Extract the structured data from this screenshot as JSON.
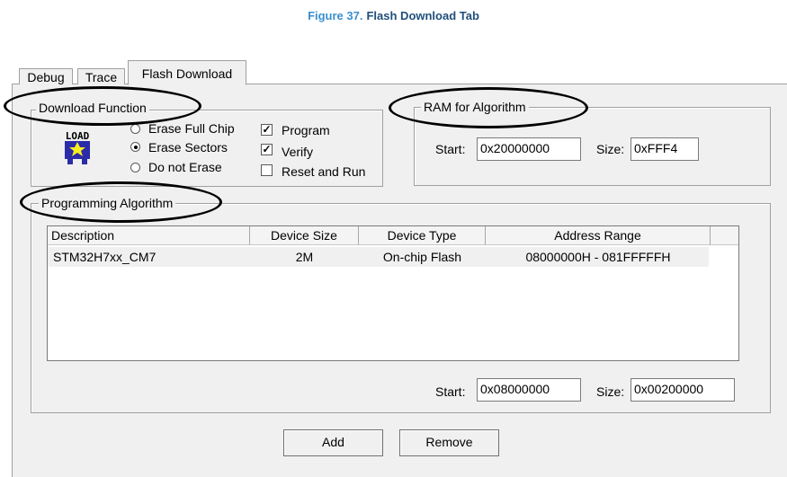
{
  "caption": {
    "number": "Figure 37.",
    "title": "Flash Download Tab"
  },
  "tabs": [
    {
      "label": "Debug"
    },
    {
      "label": "Trace"
    },
    {
      "label": "Flash Download"
    }
  ],
  "download_function": {
    "legend": "Download Function",
    "icon_text": "LOAD",
    "radios": [
      {
        "label": "Erase Full Chip",
        "selected": false
      },
      {
        "label": "Erase Sectors",
        "selected": true
      },
      {
        "label": "Do not Erase",
        "selected": false
      }
    ],
    "checks": [
      {
        "label": "Program",
        "checked": true,
        "mark": "✓"
      },
      {
        "label": "Verify",
        "checked": true,
        "mark": "✓"
      },
      {
        "label": "Reset and Run",
        "checked": false,
        "mark": ""
      }
    ]
  },
  "ram": {
    "legend": "RAM for Algorithm",
    "start_label": "Start:",
    "start_value": "0x20000000",
    "size_label": "Size:",
    "size_value": "0xFFF4"
  },
  "programming": {
    "legend": "Programming Algorithm",
    "columns": [
      "Description",
      "Device Size",
      "Device Type",
      "Address Range"
    ],
    "rows": [
      {
        "description": "STM32H7xx_CM7",
        "size": "2M",
        "type": "On-chip Flash",
        "range": "08000000H - 081FFFFFH"
      }
    ],
    "start_label": "Start:",
    "start_value": "0x08000000",
    "size_label": "Size:",
    "size_value": "0x00200000"
  },
  "buttons": {
    "add": "Add",
    "remove": "Remove"
  },
  "colors": {
    "caption_number": "#3a8fd0",
    "caption_title": "#1f4f7a",
    "dialog_bg": "#f0f0f0"
  }
}
